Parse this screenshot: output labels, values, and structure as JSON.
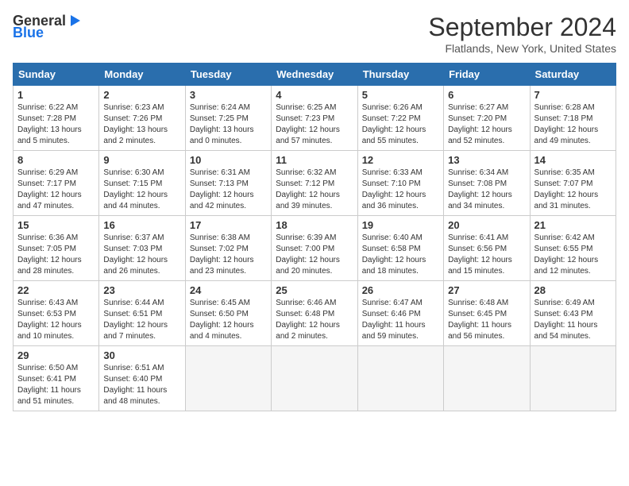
{
  "header": {
    "logo_general": "General",
    "logo_blue": "Blue",
    "month_title": "September 2024",
    "location": "Flatlands, New York, United States"
  },
  "days_of_week": [
    "Sunday",
    "Monday",
    "Tuesday",
    "Wednesday",
    "Thursday",
    "Friday",
    "Saturday"
  ],
  "weeks": [
    [
      {
        "day": "1",
        "sunrise": "6:22 AM",
        "sunset": "7:28 PM",
        "daylight": "13 hours and 5 minutes."
      },
      {
        "day": "2",
        "sunrise": "6:23 AM",
        "sunset": "7:26 PM",
        "daylight": "13 hours and 2 minutes."
      },
      {
        "day": "3",
        "sunrise": "6:24 AM",
        "sunset": "7:25 PM",
        "daylight": "13 hours and 0 minutes."
      },
      {
        "day": "4",
        "sunrise": "6:25 AM",
        "sunset": "7:23 PM",
        "daylight": "12 hours and 57 minutes."
      },
      {
        "day": "5",
        "sunrise": "6:26 AM",
        "sunset": "7:22 PM",
        "daylight": "12 hours and 55 minutes."
      },
      {
        "day": "6",
        "sunrise": "6:27 AM",
        "sunset": "7:20 PM",
        "daylight": "12 hours and 52 minutes."
      },
      {
        "day": "7",
        "sunrise": "6:28 AM",
        "sunset": "7:18 PM",
        "daylight": "12 hours and 49 minutes."
      }
    ],
    [
      {
        "day": "8",
        "sunrise": "6:29 AM",
        "sunset": "7:17 PM",
        "daylight": "12 hours and 47 minutes."
      },
      {
        "day": "9",
        "sunrise": "6:30 AM",
        "sunset": "7:15 PM",
        "daylight": "12 hours and 44 minutes."
      },
      {
        "day": "10",
        "sunrise": "6:31 AM",
        "sunset": "7:13 PM",
        "daylight": "12 hours and 42 minutes."
      },
      {
        "day": "11",
        "sunrise": "6:32 AM",
        "sunset": "7:12 PM",
        "daylight": "12 hours and 39 minutes."
      },
      {
        "day": "12",
        "sunrise": "6:33 AM",
        "sunset": "7:10 PM",
        "daylight": "12 hours and 36 minutes."
      },
      {
        "day": "13",
        "sunrise": "6:34 AM",
        "sunset": "7:08 PM",
        "daylight": "12 hours and 34 minutes."
      },
      {
        "day": "14",
        "sunrise": "6:35 AM",
        "sunset": "7:07 PM",
        "daylight": "12 hours and 31 minutes."
      }
    ],
    [
      {
        "day": "15",
        "sunrise": "6:36 AM",
        "sunset": "7:05 PM",
        "daylight": "12 hours and 28 minutes."
      },
      {
        "day": "16",
        "sunrise": "6:37 AM",
        "sunset": "7:03 PM",
        "daylight": "12 hours and 26 minutes."
      },
      {
        "day": "17",
        "sunrise": "6:38 AM",
        "sunset": "7:02 PM",
        "daylight": "12 hours and 23 minutes."
      },
      {
        "day": "18",
        "sunrise": "6:39 AM",
        "sunset": "7:00 PM",
        "daylight": "12 hours and 20 minutes."
      },
      {
        "day": "19",
        "sunrise": "6:40 AM",
        "sunset": "6:58 PM",
        "daylight": "12 hours and 18 minutes."
      },
      {
        "day": "20",
        "sunrise": "6:41 AM",
        "sunset": "6:56 PM",
        "daylight": "12 hours and 15 minutes."
      },
      {
        "day": "21",
        "sunrise": "6:42 AM",
        "sunset": "6:55 PM",
        "daylight": "12 hours and 12 minutes."
      }
    ],
    [
      {
        "day": "22",
        "sunrise": "6:43 AM",
        "sunset": "6:53 PM",
        "daylight": "12 hours and 10 minutes."
      },
      {
        "day": "23",
        "sunrise": "6:44 AM",
        "sunset": "6:51 PM",
        "daylight": "12 hours and 7 minutes."
      },
      {
        "day": "24",
        "sunrise": "6:45 AM",
        "sunset": "6:50 PM",
        "daylight": "12 hours and 4 minutes."
      },
      {
        "day": "25",
        "sunrise": "6:46 AM",
        "sunset": "6:48 PM",
        "daylight": "12 hours and 2 minutes."
      },
      {
        "day": "26",
        "sunrise": "6:47 AM",
        "sunset": "6:46 PM",
        "daylight": "11 hours and 59 minutes."
      },
      {
        "day": "27",
        "sunrise": "6:48 AM",
        "sunset": "6:45 PM",
        "daylight": "11 hours and 56 minutes."
      },
      {
        "day": "28",
        "sunrise": "6:49 AM",
        "sunset": "6:43 PM",
        "daylight": "11 hours and 54 minutes."
      }
    ],
    [
      {
        "day": "29",
        "sunrise": "6:50 AM",
        "sunset": "6:41 PM",
        "daylight": "11 hours and 51 minutes."
      },
      {
        "day": "30",
        "sunrise": "6:51 AM",
        "sunset": "6:40 PM",
        "daylight": "11 hours and 48 minutes."
      },
      null,
      null,
      null,
      null,
      null
    ]
  ],
  "labels": {
    "sunrise": "Sunrise:",
    "sunset": "Sunset:",
    "daylight": "Daylight:"
  }
}
